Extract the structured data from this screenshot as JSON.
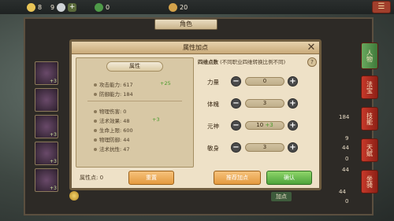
{
  "topbar": {
    "items": [
      {
        "icon": "gold-coin-icon",
        "value": "8"
      },
      {
        "icon": "silver-coin-icon",
        "value": "9"
      },
      {
        "icon": "jade-icon",
        "value": "0"
      },
      {
        "icon": "ingot-icon",
        "value": "20"
      }
    ]
  },
  "background": {
    "window_title": "角色",
    "slot_levels": [
      "+3",
      "",
      "+3",
      "+3",
      "+3"
    ],
    "side_tabs": [
      "人物",
      "法宝",
      "技能",
      "天赋",
      "坐骑"
    ],
    "side_numbers": [
      "184",
      "9",
      "44",
      "0",
      "44",
      "44",
      "0"
    ],
    "hint_button": "加点"
  },
  "dialog": {
    "title": "属性加点",
    "close_label": "✕",
    "attributes_header": "属性",
    "stats": [
      {
        "label": "攻击能力:",
        "value": "617",
        "bonus": "+25"
      },
      {
        "label": "防御能力:",
        "value": "184",
        "bonus": ""
      },
      {
        "label": "物理伤害:",
        "value": "0",
        "bonus": ""
      },
      {
        "label": "法术效果:",
        "value": "48",
        "bonus": "+3"
      },
      {
        "label": "生命上限:",
        "value": "600",
        "bonus": ""
      },
      {
        "label": "物理防御:",
        "value": "44",
        "bonus": ""
      },
      {
        "label": "法术抗性:",
        "value": "47",
        "bonus": ""
      }
    ],
    "allocate_header_bold": "四维点数",
    "allocate_header_note": "(不同职业四维转换比例不同)",
    "help_label": "?",
    "rows": [
      {
        "label": "力量",
        "value": "0",
        "bonus": ""
      },
      {
        "label": "体魄",
        "value": "3",
        "bonus": ""
      },
      {
        "label": "元神",
        "value": "10",
        "bonus": "+3"
      },
      {
        "label": "敏身",
        "value": "3",
        "bonus": ""
      }
    ],
    "minus_label": "−",
    "plus_label": "+",
    "points_label": "属性点:",
    "points_value": "0",
    "reset_button": "重置",
    "recommend_button": "推荐加点",
    "confirm_button": "确认"
  }
}
